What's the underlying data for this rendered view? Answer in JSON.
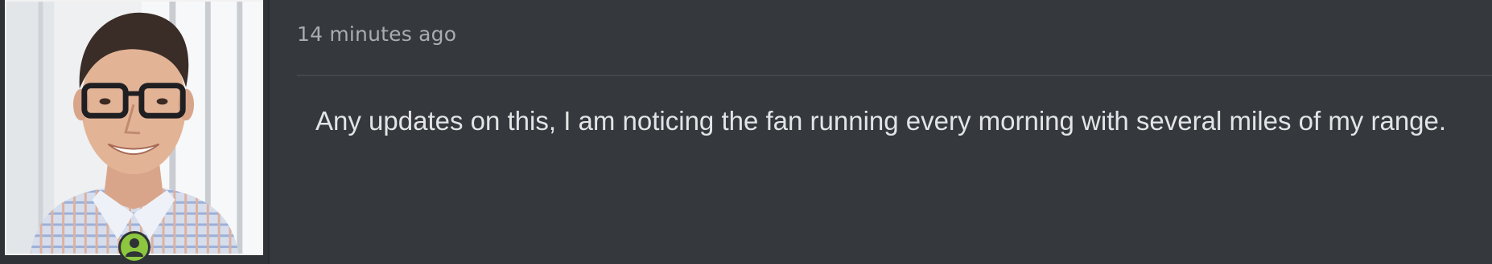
{
  "post": {
    "author": {
      "avatar_icon": "user-photo",
      "status_icon": "online-user-icon",
      "status_color": "#8dc63f"
    },
    "timestamp": "14 minutes ago",
    "body": "Any updates on this, I am noticing the fan running every morning with several miles of my range."
  }
}
